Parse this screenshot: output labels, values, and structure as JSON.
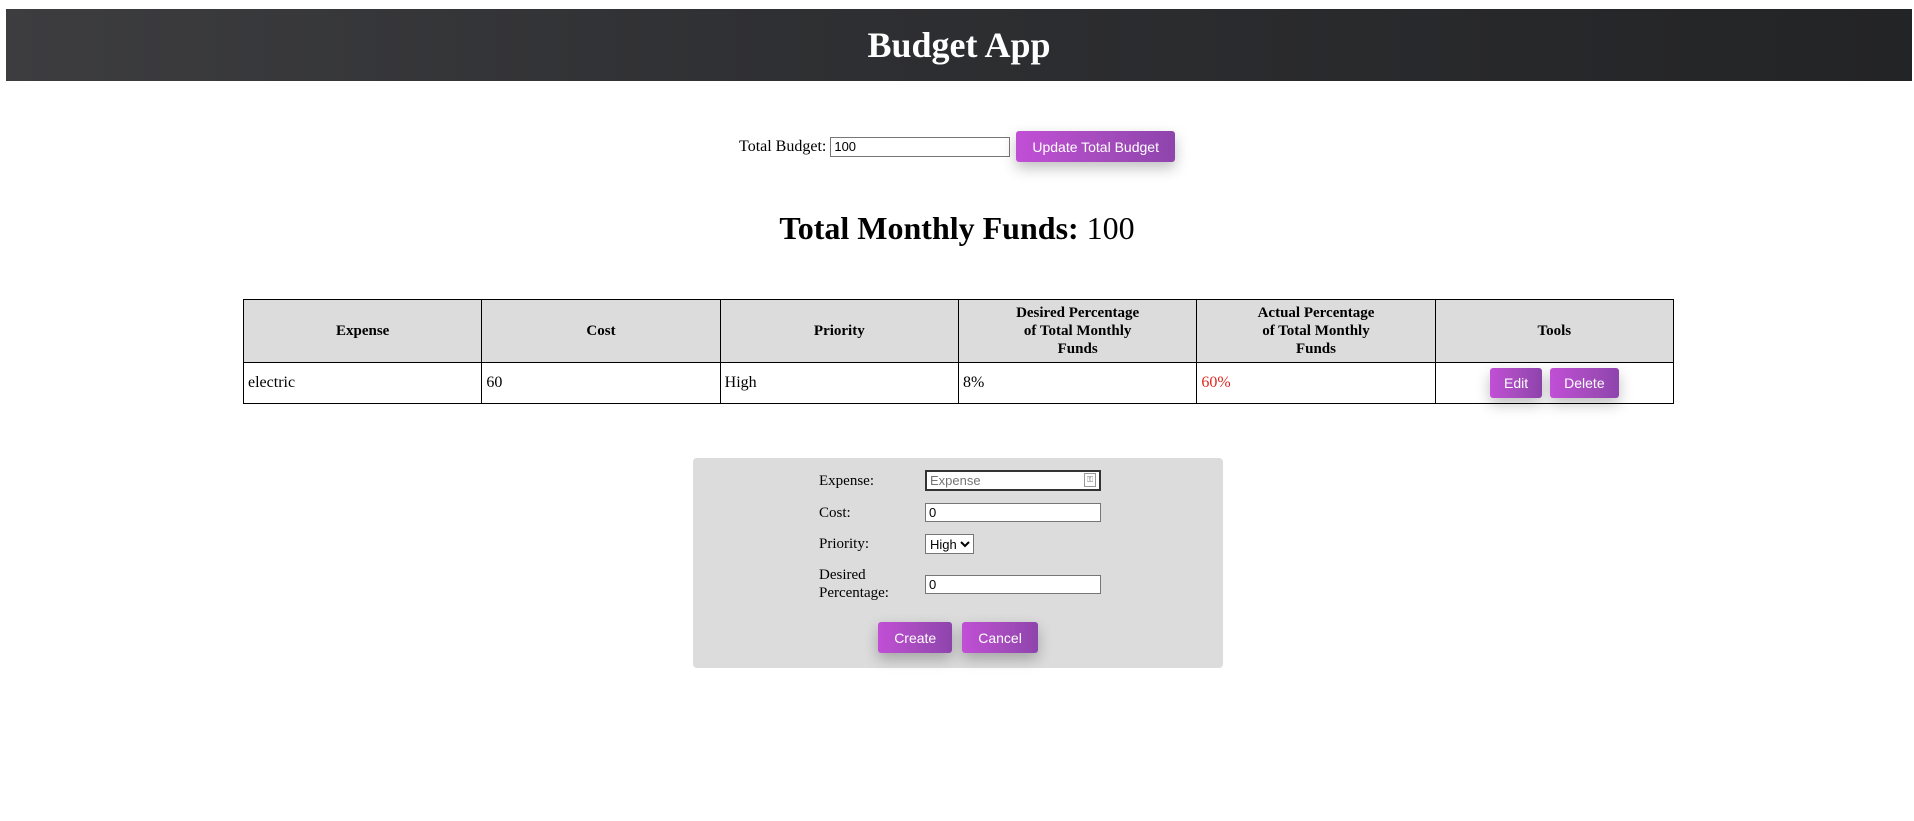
{
  "app": {
    "title": "Budget App"
  },
  "budget": {
    "label": "Total Budget:",
    "value": "100",
    "update_button": "Update Total Budget"
  },
  "funds": {
    "label": "Total Monthly Funds:",
    "value": "100"
  },
  "table": {
    "headers": {
      "expense": "Expense",
      "cost": "Cost",
      "priority": "Priority",
      "desired_line1": "Desired Percentage",
      "desired_line2": "of Total Monthly",
      "desired_line3": "Funds",
      "actual_line1": "Actual Percentage",
      "actual_line2": "of Total Monthly",
      "actual_line3": "Funds",
      "tools": "Tools"
    },
    "rows": [
      {
        "expense": "electric",
        "cost": "60",
        "priority": "High",
        "desired": "8%",
        "actual": "60%",
        "edit_label": "Edit",
        "delete_label": "Delete"
      }
    ]
  },
  "form": {
    "expense_label": "Expense:",
    "expense_placeholder": "Expense",
    "cost_label": "Cost:",
    "cost_value": "0",
    "priority_label": "Priority:",
    "priority_value": "High",
    "desired_label_line1": "Desired",
    "desired_label_line2": "Percentage:",
    "desired_value": "0",
    "create_label": "Create",
    "cancel_label": "Cancel"
  },
  "colors": {
    "header_bg": "#2f3033",
    "accent": "#a24bba",
    "over_budget": "#e0271f",
    "table_header_bg": "#dcdcdc"
  },
  "icons": {
    "autofill": "autofill-key-icon"
  }
}
